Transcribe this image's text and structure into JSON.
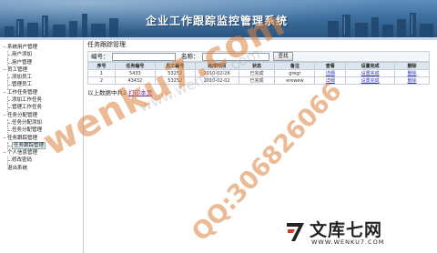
{
  "window": {
    "title": "企业工作跟踪监控管理系统"
  },
  "sidebar": {
    "items": [
      {
        "label": "系统用户管理",
        "level": 0,
        "toggle": "−"
      },
      {
        "label": "用户添加",
        "level": 1
      },
      {
        "label": "用户管理",
        "level": 1
      },
      {
        "label": "员工管理",
        "level": 0,
        "toggle": "−"
      },
      {
        "label": "添加员工",
        "level": 1
      },
      {
        "label": "管理员工",
        "level": 1
      },
      {
        "label": "工作任务管理",
        "level": 0,
        "toggle": "−"
      },
      {
        "label": "添加工作任务",
        "level": 1
      },
      {
        "label": "管理工作任务",
        "level": 1
      },
      {
        "label": "任务分配管理",
        "level": 0,
        "toggle": "−"
      },
      {
        "label": "任务分配添加",
        "level": 1
      },
      {
        "label": "任务分配管理",
        "level": 1
      },
      {
        "label": "任务跟踪管理",
        "level": 0,
        "toggle": "−"
      },
      {
        "label": "任务跟踪管理",
        "level": 1,
        "selected": true
      },
      {
        "label": "个人信息管理",
        "level": 0,
        "toggle": "−"
      },
      {
        "label": "修改密码",
        "level": 1
      },
      {
        "label": "退出系统",
        "level": 0,
        "toggle": ""
      }
    ]
  },
  "main": {
    "section_title": "任务跟踪管理",
    "search": {
      "no_label": "编号：",
      "no_value": "",
      "name_label": "名称：",
      "name_value": "",
      "button": "查找"
    },
    "table": {
      "headers": [
        "序号",
        "任务编号",
        "员工编号",
        "完成时间",
        "状态",
        "备注",
        "查看",
        "设置完成",
        "删除"
      ],
      "rows": [
        [
          "1",
          "5433",
          "53252",
          "2010-02-26",
          "已完成",
          "gregr",
          "详细",
          "设置完成",
          "删除"
        ],
        [
          "2",
          "43432",
          "53252",
          "2010-02-02",
          "已完成",
          "erewew",
          "详细",
          "设置完成",
          "删除"
        ]
      ]
    },
    "footer": {
      "text": "以上数据中共2",
      "print_link": "打印本页"
    }
  },
  "watermarks": {
    "large": "wenku7.com",
    "qq": "QQ:306826066",
    "center": "www.wenku7.com"
  },
  "logo": {
    "cn": "文库七网",
    "url": "WWW.WENKU7.COM"
  },
  "colors": {
    "banner": "#3c6e9f",
    "link": "#2f33b3",
    "header_bg": "#dde6ef",
    "watermark": "#dc823c"
  }
}
